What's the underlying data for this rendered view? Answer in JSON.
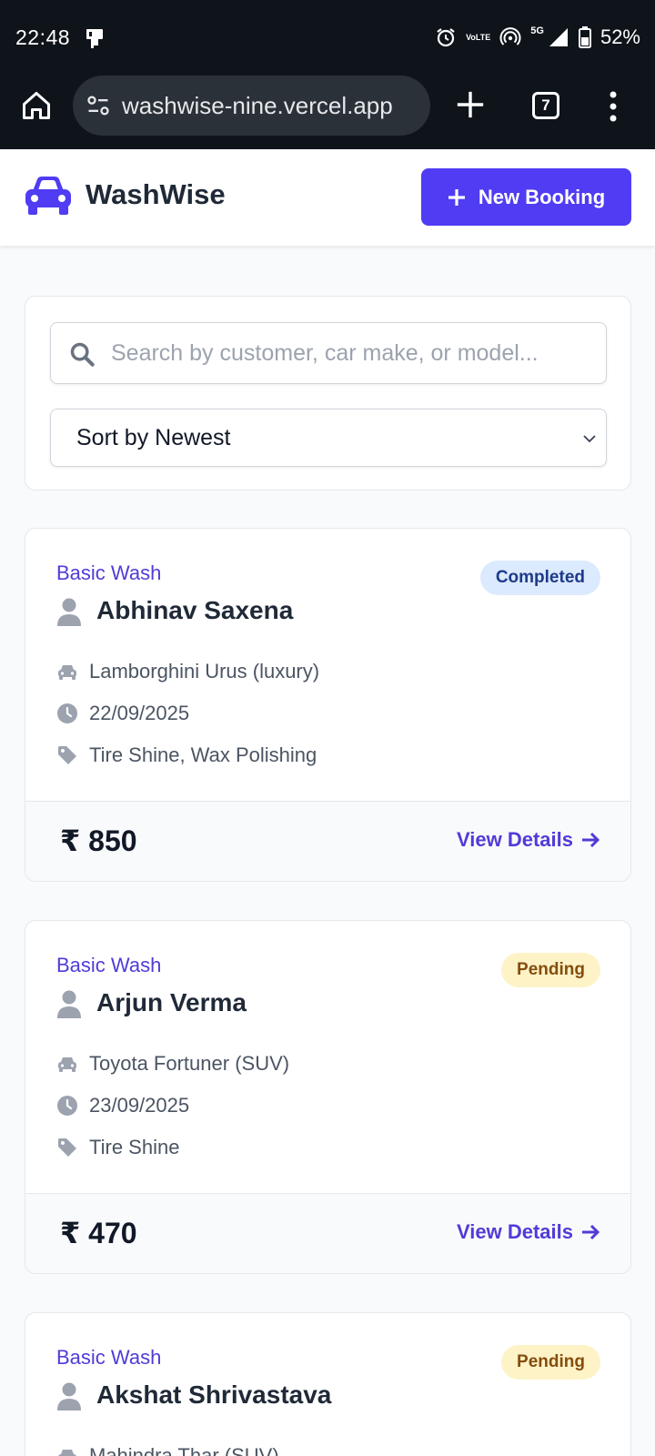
{
  "status_bar": {
    "time": "22:48",
    "battery": "52%",
    "network_5g": "5G",
    "volte_line1": "Vo",
    "volte_line2": "LTE"
  },
  "browser": {
    "url": "washwise-nine.vercel.app",
    "tab_count": "7"
  },
  "header": {
    "brand": "WashWise",
    "new_booking_label": "New Booking",
    "accent_color": "#4f3cf3"
  },
  "filters": {
    "search_placeholder": "Search by customer, car make, or model...",
    "sort_value": "Sort by Newest"
  },
  "bookings": [
    {
      "service": "Basic Wash",
      "status": "Completed",
      "customer": "Abhinav Saxena",
      "car": "Lamborghini Urus (luxury)",
      "date": "22/09/2025",
      "addons": "Tire Shine, Wax Polishing",
      "price": "₹ 850",
      "action": "View Details"
    },
    {
      "service": "Basic Wash",
      "status": "Pending",
      "customer": "Arjun Verma",
      "car": "Toyota Fortuner (SUV)",
      "date": "23/09/2025",
      "addons": "Tire Shine",
      "price": "₹ 470",
      "action": "View Details"
    },
    {
      "service": "Basic Wash",
      "status": "Pending",
      "customer": "Akshat Shrivastava",
      "car": "Mahindra Thar (SUV)"
    }
  ]
}
